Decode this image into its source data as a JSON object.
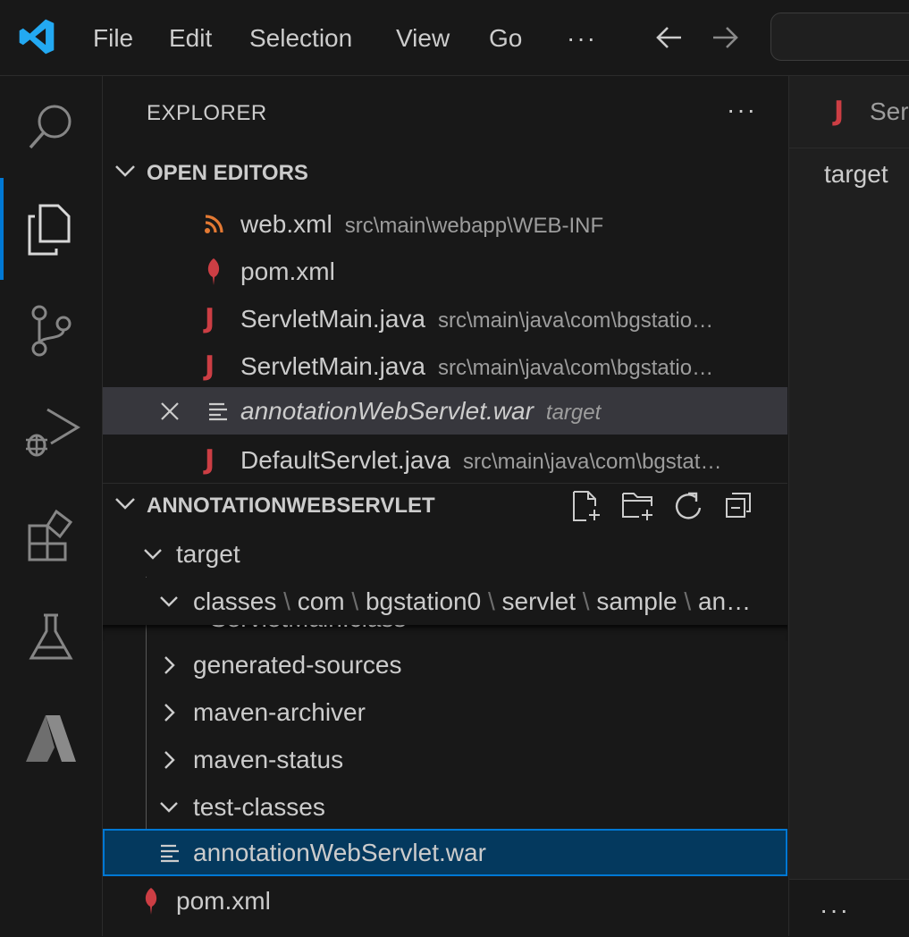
{
  "menu": {
    "file": "File",
    "edit": "Edit",
    "selection": "Selection",
    "view": "View",
    "go": "Go",
    "more": "···",
    "back_icon": "arrow-left-icon",
    "forward_icon": "arrow-right-icon"
  },
  "activity_bar": {
    "items": [
      "search-icon",
      "files-icon",
      "source-control-icon",
      "run-debug-icon",
      "extensions-icon",
      "testing-icon",
      "azure-icon"
    ],
    "active_item": "files-icon",
    "accent": "#0078d4"
  },
  "sidebar": {
    "title": "EXPLORER",
    "more": "···",
    "open_editors": {
      "header": "OPEN EDITORS",
      "items": [
        {
          "name": "web.xml",
          "desc": "src\\main\\webapp\\WEB-INF",
          "icon": "rss-icon"
        },
        {
          "name": "pom.xml",
          "desc": "",
          "icon": "maven-feather-icon"
        },
        {
          "name": "ServletMain.java",
          "desc": "src\\main\\java\\com\\bgstatio…",
          "icon": "java-icon"
        },
        {
          "name": "ServletMain.java",
          "desc": "src\\main\\java\\com\\bgstatio…",
          "icon": "java-icon"
        },
        {
          "name": "annotationWebServlet.war",
          "desc": "target",
          "icon": "file-lines-icon"
        },
        {
          "name": "DefaultServlet.java",
          "desc": "src\\main\\java\\com\\bgstat…",
          "icon": "java-icon"
        }
      ],
      "java_glyph": "J"
    },
    "project": {
      "header": "ANNOTATIONWEBSERVLET",
      "tree": [
        {
          "label": "target",
          "expanded": true
        },
        {
          "label": "classes",
          "path": [
            "com",
            "bgstation0",
            "servlet",
            "sample",
            "an…"
          ],
          "expanded": true
        },
        {
          "label": "ServletMain.class"
        },
        {
          "label": "generated-sources",
          "expanded": false
        },
        {
          "label": "maven-archiver",
          "expanded": false
        },
        {
          "label": "maven-status",
          "expanded": false
        },
        {
          "label": "test-classes",
          "expanded": true
        },
        {
          "label": "annotationWebServlet.war"
        },
        {
          "label": "pom.xml"
        }
      ],
      "path_separator": "\\"
    }
  },
  "editor": {
    "tab_label": "Ser",
    "breadcrumb": "target",
    "panel_more": "···"
  },
  "colors": {
    "java": "#cc3e44",
    "xml": "#e37933",
    "maven": "#cc3e44",
    "selection_bg": "#04395e",
    "active_bg": "#37373d"
  }
}
